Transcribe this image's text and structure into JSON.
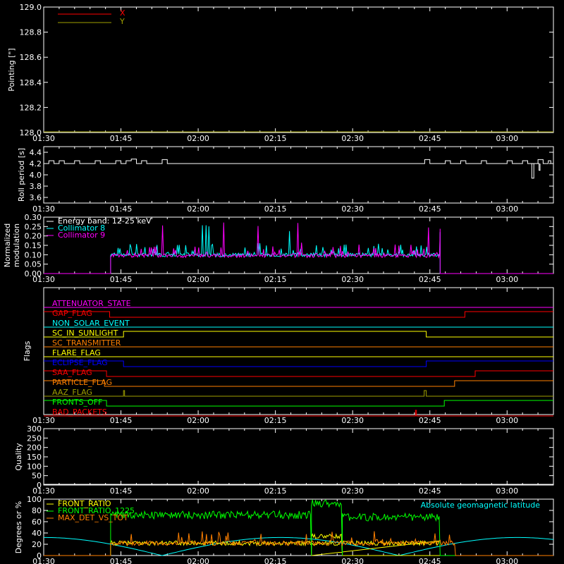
{
  "time_ticks": [
    "01:30",
    "01:45",
    "02:00",
    "02:15",
    "02:30",
    "02:45",
    "03:00"
  ],
  "chart_data": [
    {
      "type": "line",
      "ylabel": "Pointing [\"]",
      "ylim": [
        128.0,
        129.0
      ],
      "yticks": [
        "128.0",
        "128.2",
        "128.4",
        "128.6",
        "128.8",
        "129.0"
      ],
      "xlim_minutes": [
        0,
        99
      ],
      "series": [
        {
          "name": "X",
          "color": "#ff0000",
          "points": [
            [
              0,
              128.0
            ],
            [
              99,
              128.0
            ]
          ]
        },
        {
          "name": "Y",
          "color": "#a0a000",
          "points": [
            [
              0,
              128.0
            ],
            [
              99,
              128.0
            ]
          ]
        }
      ]
    },
    {
      "type": "line",
      "ylabel": "Roll period [s]",
      "ylim": [
        3.5,
        4.5
      ],
      "yticks": [
        "3.6",
        "3.8",
        "4.0",
        "4.2",
        "4.4"
      ],
      "series": [
        {
          "name": "",
          "color": "#ffffff",
          "points": [
            [
              0,
              4.2
            ],
            [
              1,
              4.25
            ],
            [
              2,
              4.2
            ],
            [
              3,
              4.25
            ],
            [
              4,
              4.2
            ],
            [
              6,
              4.25
            ],
            [
              7,
              4.2
            ],
            [
              9,
              4.2
            ],
            [
              10,
              4.25
            ],
            [
              11,
              4.2
            ],
            [
              13,
              4.2
            ],
            [
              14,
              4.25
            ],
            [
              15,
              4.2
            ],
            [
              16,
              4.25
            ],
            [
              17,
              4.28
            ],
            [
              18,
              4.2
            ],
            [
              19,
              4.25
            ],
            [
              20,
              4.2
            ],
            [
              22,
              4.2
            ],
            [
              23,
              4.27
            ],
            [
              24,
              4.2
            ],
            [
              26,
              4.2
            ],
            [
              30,
              4.2
            ],
            [
              40,
              4.2
            ],
            [
              50,
              4.2
            ],
            [
              60,
              4.2
            ],
            [
              70,
              4.2
            ],
            [
              73,
              4.2
            ],
            [
              74,
              4.27
            ],
            [
              75,
              4.2
            ],
            [
              77,
              4.2
            ],
            [
              78,
              4.25
            ],
            [
              79,
              4.2
            ],
            [
              81,
              4.25
            ],
            [
              82,
              4.2
            ],
            [
              84,
              4.2
            ],
            [
              85,
              4.25
            ],
            [
              86,
              4.2
            ],
            [
              89,
              4.2
            ],
            [
              90,
              4.25
            ],
            [
              91,
              4.2
            ],
            [
              92,
              4.2
            ],
            [
              93,
              4.25
            ],
            [
              94,
              4.2
            ],
            [
              95,
              4.2
            ],
            [
              96,
              4.27
            ],
            [
              97,
              4.2
            ],
            [
              98,
              4.25
            ],
            [
              98.5,
              4.2
            ],
            [
              99,
              4.2
            ]
          ]
        }
      ]
    },
    {
      "type": "line",
      "ylabel": "Normalized modulation",
      "ylim": [
        0.0,
        0.3
      ],
      "yticks": [
        "0.00",
        "0.05",
        "0.10",
        "0.15",
        "0.20",
        "0.25",
        "0.30"
      ],
      "legend": [
        "Energy band: 12-25 keV",
        "Collimator 8",
        "Collimator 9"
      ],
      "active_range_minutes": [
        13,
        77
      ],
      "series": [
        {
          "name": "Collimator 8",
          "color": "#00ffff",
          "baseline": 0.1,
          "max": 0.26
        },
        {
          "name": "Collimator 9",
          "color": "#ff00ff",
          "baseline": 0.095,
          "max": 0.28
        }
      ]
    },
    {
      "type": "line",
      "ylabel": "Flags",
      "flags": [
        {
          "name": "ATTENUATOR_STATE",
          "color": "#ff00ff",
          "steps": [
            [
              0,
              0
            ],
            [
              99,
              0
            ]
          ],
          "label_pos": "top"
        },
        {
          "name": "GAP_FLAG",
          "color": "#ff0000",
          "steps": [
            [
              0,
              1
            ],
            [
              12.8,
              0
            ],
            [
              81.8,
              1
            ],
            [
              99,
              1
            ]
          ]
        },
        {
          "name": "NON_SOLAR_EVENT",
          "color": "#00ffff",
          "steps": [
            [
              0,
              0
            ],
            [
              99,
              0
            ]
          ]
        },
        {
          "name": "SC_IN_SUNLIGHT",
          "color": "#ffff00",
          "steps": [
            [
              0,
              0
            ],
            [
              15.5,
              1
            ],
            [
              74.3,
              0
            ],
            [
              99,
              0
            ]
          ]
        },
        {
          "name": "SC_TRANSMITTER",
          "color": "#ff8000",
          "steps": [
            [
              0,
              0
            ],
            [
              99,
              0
            ]
          ]
        },
        {
          "name": "FLARE_FLAG",
          "color": "#ffff00",
          "steps": [
            [
              0,
              0
            ],
            [
              99,
              0
            ]
          ]
        },
        {
          "name": "ECLIPSE_FLAG",
          "color": "#0000ff",
          "steps": [
            [
              0,
              1
            ],
            [
              15.5,
              0
            ],
            [
              74.3,
              1
            ],
            [
              99,
              1
            ]
          ]
        },
        {
          "name": "SAA_FLAG",
          "color": "#ff0000",
          "steps": [
            [
              0,
              1
            ],
            [
              12.2,
              0
            ],
            [
              83.8,
              1
            ],
            [
              99,
              1
            ]
          ]
        },
        {
          "name": "PARTICLE_FLAG",
          "color": "#ff8000",
          "steps": [
            [
              0,
              1
            ],
            [
              11.8,
              0
            ],
            [
              79.8,
              1
            ],
            [
              99,
              1
            ]
          ]
        },
        {
          "name": "AAZ_FLAG",
          "color": "#a0a000",
          "steps": [
            [
              0,
              0
            ],
            [
              15.5,
              1
            ],
            [
              15.7,
              0
            ],
            [
              73.9,
              1
            ],
            [
              74.3,
              0
            ],
            [
              99,
              0
            ]
          ]
        },
        {
          "name": "FRONTS_OFF",
          "color": "#00ff00",
          "steps": [
            [
              0,
              1
            ],
            [
              12.2,
              0
            ],
            [
              77.8,
              1
            ],
            [
              99,
              1
            ]
          ]
        },
        {
          "name": "BAD_PACKETS",
          "color": "#ff0000",
          "steps": [
            [
              0,
              0
            ],
            [
              72.2,
              1
            ],
            [
              72.4,
              0
            ],
            [
              99,
              0
            ]
          ]
        }
      ]
    },
    {
      "type": "line",
      "ylabel": "Quality",
      "ylim": [
        0,
        300
      ],
      "yticks": [
        "0",
        "50",
        "100",
        "150",
        "200",
        "250",
        "300"
      ],
      "series": [
        {
          "name": "",
          "color": "#ffffff",
          "points": [
            [
              0,
              0
            ],
            [
              99,
              0
            ]
          ]
        }
      ]
    },
    {
      "type": "line",
      "ylabel": "Degrees or %",
      "ylim": [
        0,
        100
      ],
      "yticks": [
        "0",
        "20",
        "40",
        "60",
        "80",
        "100"
      ],
      "legend_right": "Absolute geomagnetic latitude",
      "series": [
        {
          "name": "FRONT_RATIO",
          "color": "#ffff00",
          "segments": [
            [
              13,
              77,
              22
            ],
            [
              52,
              58,
              34
            ]
          ]
        },
        {
          "name": "FRONT_RATIO_1225",
          "color": "#00ff00",
          "segments": [
            [
              13,
              52,
              72
            ],
            [
              52,
              58,
              93
            ],
            [
              58,
              77,
              68
            ]
          ]
        },
        {
          "name": "MAX_DET_VS_TOT",
          "color": "#ff8000",
          "segments": [
            [
              13,
              80,
              22
            ]
          ]
        },
        {
          "name": "Absolute geomagnetic latitude",
          "color": "#00ffff",
          "curve": "abs_sine",
          "amplitude": 32,
          "period_minutes": 46
        }
      ]
    }
  ]
}
